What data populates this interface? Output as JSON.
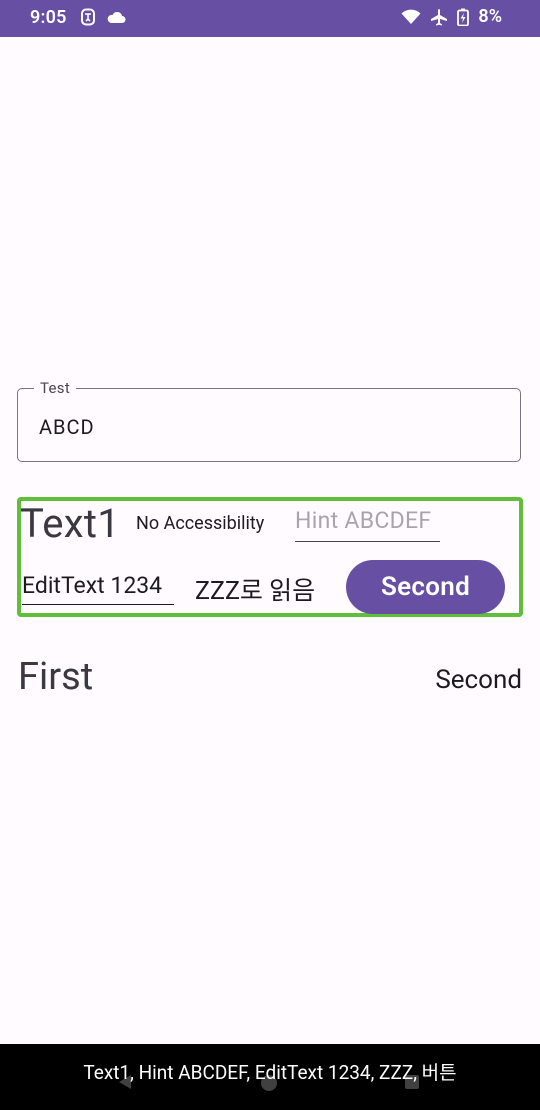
{
  "status_bar": {
    "time": "9:05",
    "battery": "8%",
    "bg_color": "#6750A4",
    "left_icons": [
      "accessibility-icon",
      "cloud-icon"
    ],
    "right_icons": [
      "wifi-icon",
      "airplane-icon",
      "battery-icon"
    ]
  },
  "test_field": {
    "label": "Test",
    "value": "ABCD"
  },
  "group": {
    "highlight_color": "#5FBF3A",
    "text1": "Text1",
    "no_accessibility": "No Accessibility",
    "hint": "Hint ABCDEF",
    "edittext": "EditText 1234",
    "zzz": "ZZZ로 읽음",
    "button": "Second"
  },
  "row": {
    "first": "First",
    "second": "Second"
  },
  "caption": "Text1, Hint ABCDEF, EditText 1234, ZZZ, 버튼",
  "accent": "#6750A4"
}
